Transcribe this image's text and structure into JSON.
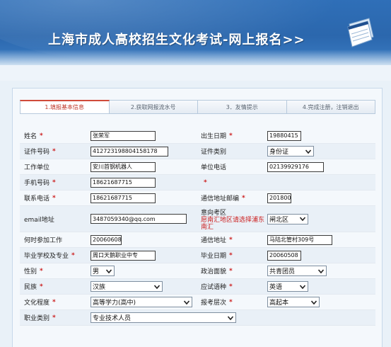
{
  "banner": {
    "title": "上海市成人高校招生文化考试-网上报名>>"
  },
  "tabs": [
    {
      "label": "1.填报基本信息",
      "active": true
    },
    {
      "label": "2.获取网报流水号",
      "active": false
    },
    {
      "label": "3．友情提示",
      "active": false
    },
    {
      "label": "4.完成注册，注销退出",
      "active": false
    }
  ],
  "required_mark": "*",
  "form": {
    "name": {
      "label": "姓名",
      "value": "张荣军"
    },
    "birth": {
      "label": "出生日期",
      "value": "19880415"
    },
    "id_no": {
      "label": "证件号码",
      "value": "412723198804158178"
    },
    "id_type": {
      "label": "证件类别",
      "value": "身份证"
    },
    "employer": {
      "label": "工作单位",
      "value": "安川首钢机器人"
    },
    "work_phone": {
      "label": "单位电话",
      "value": "02139929176"
    },
    "mobile": {
      "label": "手机号码",
      "value": "18621687715"
    },
    "contact_phone": {
      "label": "联系电话",
      "value": "18621687715"
    },
    "postcode": {
      "label": "通信地址邮编",
      "value": "201800"
    },
    "email": {
      "label": "email地址",
      "value": "3487059340@qq.com"
    },
    "exam_area": {
      "label": "意向考区",
      "note": "愿南汇地区请选择浦东南汇",
      "value": "闸北区"
    },
    "work_start": {
      "label": "何时参加工作",
      "value": "20060608"
    },
    "address": {
      "label": "通信地址",
      "value": "马陆北管村309号"
    },
    "school": {
      "label": "毕业学校及专业",
      "value": "周口天鹅职业中专"
    },
    "grad_date": {
      "label": "毕业日期",
      "value": "20060508"
    },
    "gender": {
      "label": "性别",
      "value": "男"
    },
    "politics": {
      "label": "政治面貌",
      "value": "共青团员"
    },
    "ethnicity": {
      "label": "民族",
      "value": "汉族"
    },
    "exam_language": {
      "label": "应试语种",
      "value": "英语"
    },
    "education": {
      "label": "文化程度",
      "value": "高等学力(高中)"
    },
    "level": {
      "label": "报考层次",
      "value": "高起本"
    },
    "job_type": {
      "label": "职业类别",
      "value": "专业技术人员"
    }
  },
  "colors": {
    "banner": "#2f6fb8",
    "required": "#cc1f1f",
    "active_tab": "#c0392b"
  },
  "icons": {
    "banner_icon": "paper-stack-icon",
    "dropdown": "chevron-down-icon"
  }
}
